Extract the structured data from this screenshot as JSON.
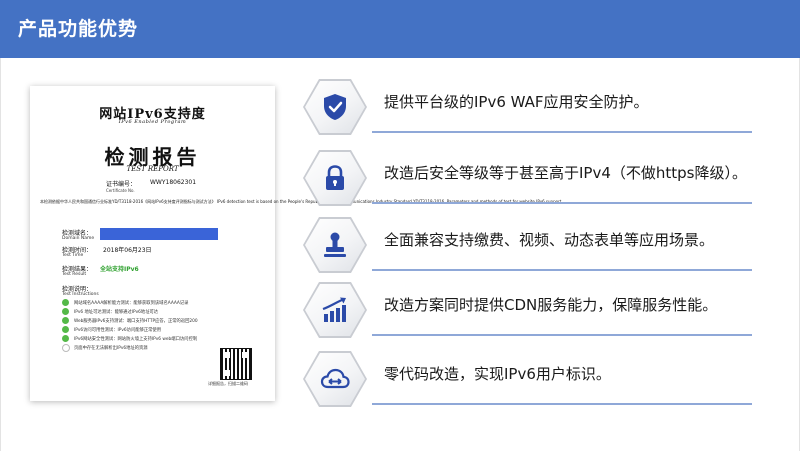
{
  "header": {
    "title": "产品功能优势"
  },
  "certificate": {
    "title": "网站IPv6支持度",
    "subtitle": "IPv6 Enabled Program",
    "report_title": "检测报告",
    "report_title_en": "TEST REPORT",
    "cert_no_label": "证书编号：",
    "cert_no_label_en": "Certificate No.",
    "cert_no": "WWY18062301",
    "basis_text": "本检测依据中华人民共和国通信行业标准YD/T3118-2016《网站IPv6支持度评测指标与测试方法》 IPv6 detection test is based on the People's Republic of China communications Industry Standard YD/T3118-2016, Parameters and methods of test for website IPv6 support.",
    "domain_label": "检测域名：",
    "domain_label_en": "Domain Name",
    "time_label": "检测时间：",
    "time_label_en": "Test Time",
    "time_value": "2018年06月23日",
    "result_label": "检测结果：",
    "result_label_en": "Test Result",
    "result_value": "全站支持IPv6",
    "instructions_label": "检测说明：",
    "instructions_label_en": "Test Instructions",
    "items": [
      "网站域名AAAA解析能力测试：能够获取到该域名AAAA记录",
      "IPv6 地址可达测试：能够通过IPv6地址可达",
      "Web服务器IPv6支持测试：端口支持HTTP应答，正常的返回200",
      "IPv6访问可用性测试：IPv6访问能够正常使用",
      "IPv6网站安全性测试：网站防火墙上支持IPv6 web端口访问控制",
      "页面中存在无法解析出IPv6地址的资源"
    ],
    "qr_caption": "详细报告，扫描二维码"
  },
  "features": [
    {
      "icon": "shield-check-icon",
      "text": "提供平台级的IPv6 WAF应用安全防护。"
    },
    {
      "icon": "lock-icon",
      "text": "改造后安全等级等于甚至高于IPv4（不做https降级）。"
    },
    {
      "icon": "stamp-icon",
      "text": "全面兼容支持缴费、视频、动态表单等应用场景。"
    },
    {
      "icon": "bar-chart-icon",
      "text": "改造方案同时提供CDN服务能力，保障服务性能。"
    },
    {
      "icon": "cloud-arrows-icon",
      "text": "零代码改造，实现IPv6用户标识。"
    }
  ],
  "colors": {
    "header": "#4472c4",
    "icon": "#2b4aa8",
    "accent_line": "#8fa8d8",
    "result_green": "#2fa12f"
  }
}
